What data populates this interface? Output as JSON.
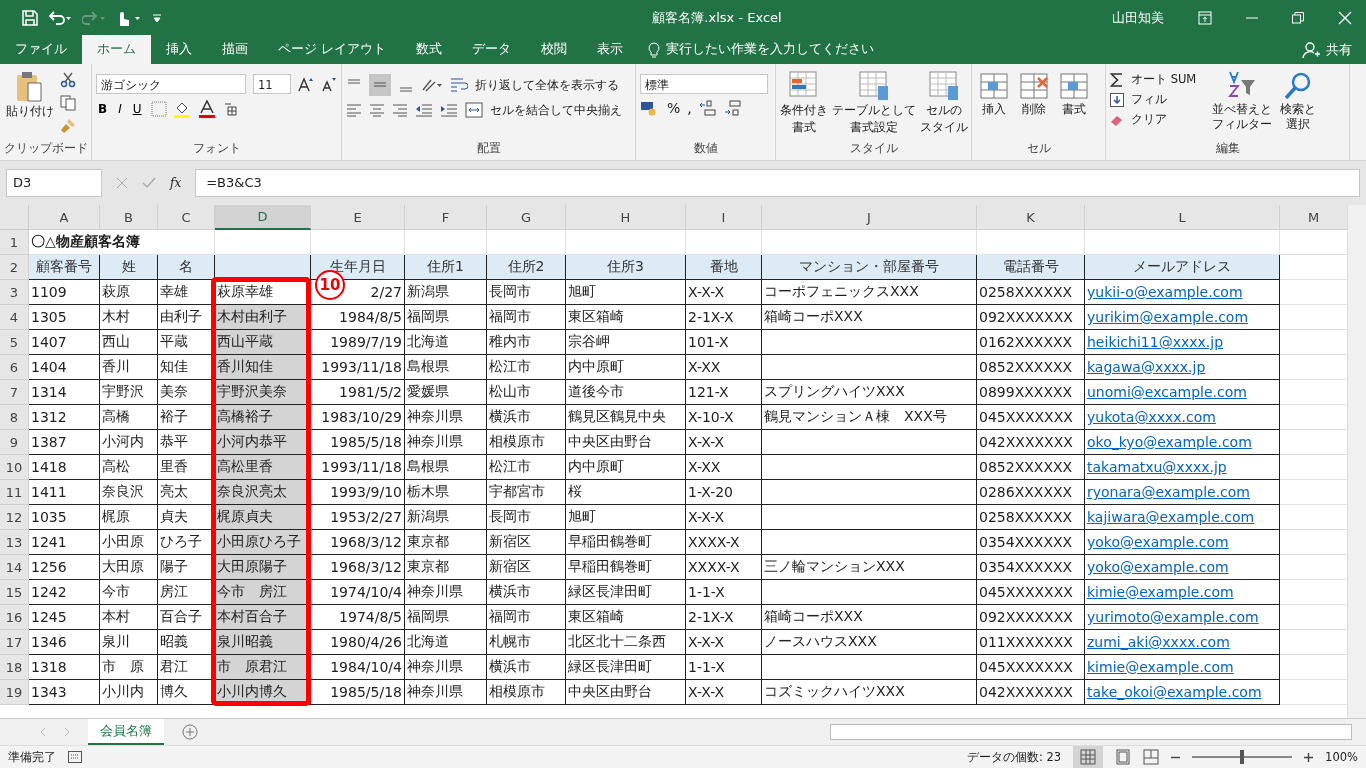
{
  "title_bar": {
    "document": "顧客名簿.xlsx  -  Excel",
    "user": "山田知美"
  },
  "ribbon_tabs": [
    {
      "label": "ファイル",
      "selected": false
    },
    {
      "label": "ホーム",
      "selected": true
    },
    {
      "label": "挿入",
      "selected": false
    },
    {
      "label": "描画",
      "selected": false
    },
    {
      "label": "ページ レイアウト",
      "selected": false
    },
    {
      "label": "数式",
      "selected": false
    },
    {
      "label": "データ",
      "selected": false
    },
    {
      "label": "校閲",
      "selected": false
    },
    {
      "label": "表示",
      "selected": false
    }
  ],
  "tell_me": "実行したい作業を入力してください",
  "share": "共有",
  "ribbon": {
    "clipboard": {
      "paste": "貼り付け",
      "label": "クリップボード"
    },
    "font": {
      "name": "游ゴシック",
      "size": "11",
      "bold": "B",
      "italic": "I",
      "underline": "U",
      "label": "フォント"
    },
    "alignment": {
      "wrap": "折り返して全体を表示する",
      "merge": "セルを結合して中央揃え",
      "label": "配置"
    },
    "number": {
      "format": "標準",
      "percent": "%",
      "comma": ",",
      "label": "数値"
    },
    "styles": {
      "buttons": [
        [
          "条件付き",
          "書式"
        ],
        [
          "テーブルとして",
          "書式設定"
        ],
        [
          "セルの",
          "スタイル"
        ]
      ],
      "label": "スタイル"
    },
    "cells": {
      "buttons": [
        "挿入",
        "削除",
        "書式"
      ],
      "label": "セル"
    },
    "editing": {
      "autosum": "オート SUM",
      "fill": "フィル",
      "clear": "クリア",
      "sort": [
        "並べ替えと",
        "フィルター"
      ],
      "find": [
        "検索と",
        "選択"
      ],
      "label": "編集"
    }
  },
  "name_box": "D3",
  "function_symbol": "fx",
  "formula": "=B3&C3",
  "columns": [
    {
      "label": "A",
      "selected": false
    },
    {
      "label": "B",
      "selected": false
    },
    {
      "label": "C",
      "selected": false
    },
    {
      "label": "D",
      "selected": true
    },
    {
      "label": "E",
      "selected": false
    },
    {
      "label": "F",
      "selected": false
    },
    {
      "label": "G",
      "selected": false
    },
    {
      "label": "H",
      "selected": false
    },
    {
      "label": "I",
      "selected": false
    },
    {
      "label": "J",
      "selected": false
    },
    {
      "label": "K",
      "selected": false
    },
    {
      "label": "L",
      "selected": false
    },
    {
      "label": "M",
      "selected": false
    }
  ],
  "sheet_title": {
    "row": "1",
    "text": "〇△物産顧客名簿"
  },
  "header_row": {
    "row": "2",
    "cells": [
      "顧客番号",
      "姓",
      "名",
      null,
      "生年月日",
      "住所1",
      "住所2",
      "住所3",
      "番地",
      "マンション・部屋番号",
      "電話番号",
      "メールアドレス"
    ]
  },
  "rows": [
    {
      "row": "3",
      "active": true,
      "cells": [
        "1109",
        "萩原",
        "幸雄",
        "萩原幸雄",
        "2/27",
        "新潟県",
        "長岡市",
        "旭町",
        "X-X-X",
        "コーポフェニックスXXX",
        "0258XXXXXX",
        "yukii-o@example.com"
      ]
    },
    {
      "row": "4",
      "active": false,
      "cells": [
        "1305",
        "木村",
        "由利子",
        "木村由利子",
        "1984/8/5",
        "福岡県",
        "福岡市",
        "東区箱崎",
        "2-1X-X",
        "箱崎コーポXXX",
        "092XXXXXXX",
        "yurikim@example.com"
      ]
    },
    {
      "row": "5",
      "active": false,
      "cells": [
        "1407",
        "西山",
        "平蔵",
        "西山平蔵",
        "1989/7/19",
        "北海道",
        "稚内市",
        "宗谷岬",
        "101-X",
        null,
        "0162XXXXXX",
        "heikichi11@xxxx.jp"
      ]
    },
    {
      "row": "6",
      "active": false,
      "cells": [
        "1404",
        "香川",
        "知佳",
        "香川知佳",
        "1993/11/18",
        "島根県",
        "松江市",
        "内中原町",
        "X-XX",
        null,
        "0852XXXXXX",
        "kagawa@xxxx.jp"
      ]
    },
    {
      "row": "7",
      "active": false,
      "cells": [
        "1314",
        "宇野沢",
        "美奈",
        "宇野沢美奈",
        "1981/5/2",
        "愛媛県",
        "松山市",
        "道後今市",
        "121-X",
        "スプリングハイツXXX",
        "0899XXXXXX",
        "unomi@excample.com"
      ]
    },
    {
      "row": "8",
      "active": false,
      "cells": [
        "1312",
        "高橋",
        "裕子",
        "高橋裕子",
        "1983/10/29",
        "神奈川県",
        "横浜市",
        "鶴見区鶴見中央",
        "X-10-X",
        "鶴見マンションＡ棟　XXX号",
        "045XXXXXXX",
        "yukota@xxxx.com"
      ]
    },
    {
      "row": "9",
      "active": false,
      "cells": [
        "1387",
        "小河内",
        "恭平",
        "小河内恭平",
        "1985/5/18",
        "神奈川県",
        "相模原市",
        "中央区由野台",
        "X-X-X",
        null,
        "042XXXXXXX",
        "oko_kyo@example.com"
      ]
    },
    {
      "row": "10",
      "active": false,
      "cells": [
        "1418",
        "高松",
        "里香",
        "高松里香",
        "1993/11/18",
        "島根県",
        "松江市",
        "内中原町",
        "X-XX",
        null,
        "0852XXXXXX",
        "takamatxu@xxxx.jp"
      ]
    },
    {
      "row": "11",
      "active": false,
      "cells": [
        "1411",
        "奈良沢",
        "亮太",
        "奈良沢亮太",
        "1993/9/10",
        "栃木県",
        "宇都宮市",
        "桜",
        "1-X-20",
        null,
        "0286XXXXXX",
        "ryonara@example.com"
      ]
    },
    {
      "row": "12",
      "active": false,
      "cells": [
        "1035",
        "梶原",
        "貞夫",
        "梶原貞夫",
        "1953/2/27",
        "新潟県",
        "長岡市",
        "旭町",
        "X-X-X",
        null,
        "0258XXXXXX",
        "kajiwara@example.com"
      ]
    },
    {
      "row": "13",
      "active": false,
      "cells": [
        "1241",
        "小田原",
        "ひろ子",
        "小田原ひろ子",
        "1968/3/12",
        "東京都",
        "新宿区",
        "早稲田鶴巻町",
        "XXXX-X",
        null,
        "0354XXXXXX",
        "yoko@example.com"
      ]
    },
    {
      "row": "14",
      "active": false,
      "cells": [
        "1256",
        "大田原",
        "陽子",
        "大田原陽子",
        "1968/3/12",
        "東京都",
        "新宿区",
        "早稲田鶴巻町",
        "XXXX-X",
        "三ノ輪マンションXXX",
        "0354XXXXXX",
        "yoko@example.com"
      ]
    },
    {
      "row": "15",
      "active": false,
      "cells": [
        "1242",
        "今市",
        "房江",
        "今市　房江",
        "1974/10/4",
        "神奈川県",
        "横浜市",
        "緑区長津田町",
        "1-1-X",
        null,
        "045XXXXXXX",
        "kimie@example.com"
      ]
    },
    {
      "row": "16",
      "active": false,
      "cells": [
        "1245",
        "本村",
        "百合子",
        "本村百合子",
        "1974/8/5",
        "福岡県",
        "福岡市",
        "東区箱崎",
        "2-1X-X",
        "箱崎コーポXXX",
        "092XXXXXXX",
        "yurimoto@example.com"
      ]
    },
    {
      "row": "17",
      "active": false,
      "cells": [
        "1346",
        "泉川",
        "昭義",
        "泉川昭義",
        "1980/4/26",
        "北海道",
        "札幌市",
        "北区北十二条西",
        "X-X-X",
        "ノースハウスXXX",
        "011XXXXXXX",
        "zumi_aki@xxxx.com"
      ]
    },
    {
      "row": "18",
      "active": false,
      "cells": [
        "1318",
        "市　原",
        "君江",
        "市　原君江",
        "1984/10/4",
        "神奈川県",
        "横浜市",
        "緑区長津田町",
        "1-1-X",
        null,
        "045XXXXXXX",
        "kimie@example.com"
      ]
    },
    {
      "row": "19",
      "active": false,
      "cells": [
        "1343",
        "小川内",
        "博久",
        "小川内博久",
        "1985/5/18",
        "神奈川県",
        "相模原市",
        "中央区由野台",
        "X-X-X",
        "コズミックハイツXXX",
        "042XXXXXXX",
        "take_okoi@example.com"
      ]
    }
  ],
  "annotation": {
    "badge": "10"
  },
  "sheet_tabs": [
    {
      "label": "会員名簿",
      "selected": true
    }
  ],
  "status_bar": {
    "status": "準備完了",
    "count": "データの個数: 23",
    "zoom": {
      "level": 0.5,
      "reading": "100%"
    }
  }
}
